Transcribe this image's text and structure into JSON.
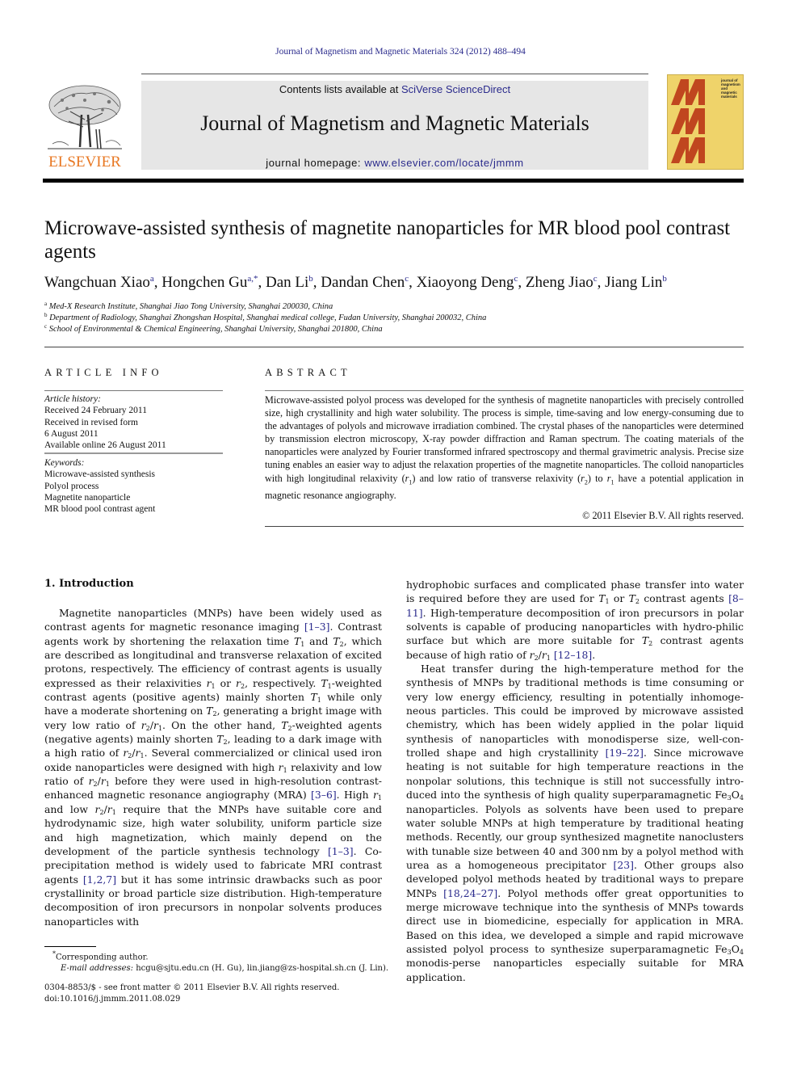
{
  "running_head": "Journal of Magnetism and Magnetic Materials 324 (2012) 488–494",
  "header": {
    "publisher": "ELSEVIER",
    "contents_prefix": "Contents lists available at ",
    "contents_link": "SciVerse ScienceDirect",
    "journal_title": "Journal of Magnetism and Magnetic Materials",
    "homepage_prefix": "journal homepage: ",
    "homepage_link": "www.elsevier.com/locate/jmmm",
    "cover_text": [
      "journal of",
      "magnetism",
      "and",
      "magnetic",
      "materials"
    ],
    "colors": {
      "link": "#2a2a8c",
      "elsevier_orange": "#e87722",
      "cover_bg": "#efd36a",
      "cover_m": "#c0461f",
      "banner_bg": "#e6e6e6"
    }
  },
  "article": {
    "title": "Microwave-assisted synthesis of magnetite nanoparticles for MR blood pool contrast agents",
    "authors": [
      {
        "name": "Wangchuan Xiao",
        "sup": "a"
      },
      {
        "name": "Hongchen Gu",
        "sup": "a,*"
      },
      {
        "name": "Dan Li",
        "sup": "b"
      },
      {
        "name": "Dandan Chen",
        "sup": "c"
      },
      {
        "name": "Xiaoyong Deng",
        "sup": "c"
      },
      {
        "name": "Zheng Jiao",
        "sup": "c"
      },
      {
        "name": "Jiang Lin",
        "sup": "b"
      }
    ],
    "affiliations": [
      {
        "mark": "a",
        "text": "Med-X Research Institute, Shanghai Jiao Tong University, Shanghai 200030, China"
      },
      {
        "mark": "b",
        "text": "Department of Radiology, Shanghai Zhongshan Hospital, Shanghai medical college, Fudan University, Shanghai 200032, China"
      },
      {
        "mark": "c",
        "text": "School of Environmental & Chemical Engineering, Shanghai University, Shanghai 201800, China"
      }
    ]
  },
  "article_info": {
    "heading": "ARTICLE INFO",
    "history_label": "Article history:",
    "history": [
      "Received 24 February 2011",
      "Received in revised form",
      "6 August 2011",
      "Available online 26 August 2011"
    ],
    "keywords_label": "Keywords:",
    "keywords": [
      "Microwave-assisted synthesis",
      "Polyol process",
      "Magnetite nanoparticle",
      "MR blood pool contrast agent"
    ]
  },
  "abstract": {
    "heading": "ABSTRACT",
    "text_1": "Microwave-assisted polyol process was developed for the synthesis of magnetite nanoparticles with precisely controlled size, high crystallinity and high water solubility. The process is simple, time-saving and low energy-consuming due to the advantages of polyols and microwave irradiation combined. The crystal phases of the nanoparticles were determined by transmission electron microscopy, X-ray powder diffraction and Raman spectrum. The coating materials of the nanoparticles were analyzed by Fourier transformed infrared spectroscopy and thermal gravimetric analysis. Precise size tuning enables an easier way to adjust the relaxation properties of the magnetite nanoparticles. The colloid nanoparticles with high longitudinal relaxivity (",
    "text_2": ") and low ratio of transverse relaxivity (",
    "text_3": ") to ",
    "text_4": " have a potential application in magnetic resonance angiography.",
    "copyright": "© 2011 Elsevier B.V. All rights reserved."
  },
  "introduction": {
    "heading": "1.  Introduction",
    "refs": [
      "[1–3]",
      "[3–6]",
      "[1–3]",
      "[1,2,7]",
      "[8–11]",
      "[12–18]",
      "[19–22]",
      "[23]",
      "[18,24–27]"
    ]
  },
  "footnotes": {
    "corresponding": "Corresponding author.",
    "email_label": "E-mail addresses:",
    "emails": "hcgu@sjtu.edu.cn (H. Gu), lin.jiang@zs-hospital.sh.cn (J. Lin).",
    "front_matter": "0304-8853/$ - see front matter © 2011 Elsevier B.V. All rights reserved.",
    "doi": "doi:10.1016/j.jmmm.2011.08.029"
  }
}
